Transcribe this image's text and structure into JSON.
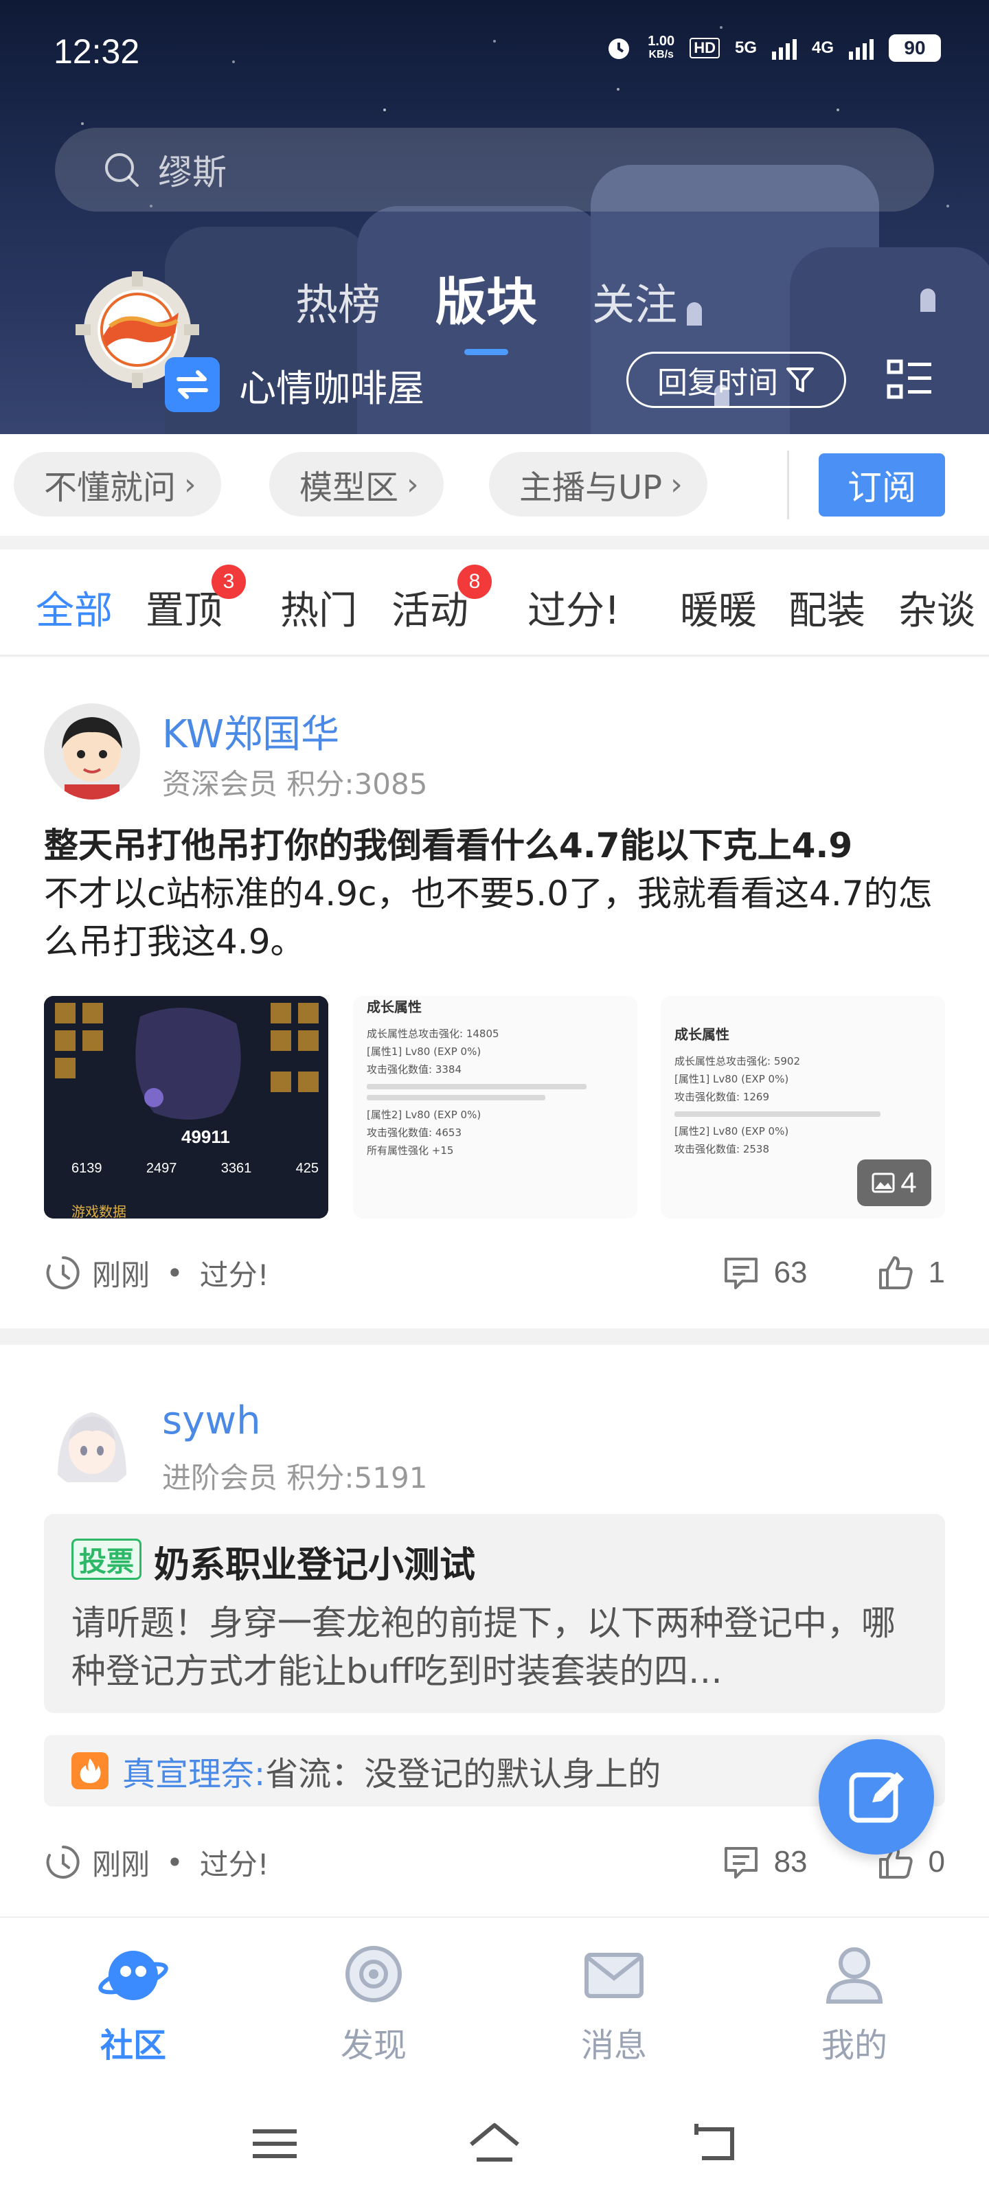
{
  "status_bar": {
    "time": "12:32",
    "speed_value": "1.00",
    "speed_unit": "KB/s",
    "hd": "HD",
    "net1": "5G",
    "net2": "4G",
    "battery": "90"
  },
  "header": {
    "search_placeholder": "缪斯",
    "tabs": [
      {
        "label": "热榜",
        "active": false
      },
      {
        "label": "版块",
        "active": true
      },
      {
        "label": "关注",
        "active": false
      }
    ],
    "forum_name": "心情咖啡屋",
    "sort_label": "回复时间"
  },
  "subforums": {
    "chips": [
      "不懂就问",
      "模型区",
      "主播与UP"
    ],
    "subscribe_label": "订阅"
  },
  "category_tabs": [
    {
      "label": "全部",
      "active": true,
      "badge": null
    },
    {
      "label": "置顶",
      "active": false,
      "badge": "3"
    },
    {
      "label": "热门",
      "active": false,
      "badge": null
    },
    {
      "label": "活动",
      "active": false,
      "badge": "8"
    },
    {
      "label": "过分!",
      "active": false,
      "badge": null
    },
    {
      "label": "暖暖",
      "active": false,
      "badge": null
    },
    {
      "label": "配装",
      "active": false,
      "badge": null
    },
    {
      "label": "杂谈",
      "active": false,
      "badge": null
    }
  ],
  "posts": [
    {
      "author": "KW郑国华",
      "rank": "资深会员",
      "score": "积分:3085",
      "title_bold": "整天吊打他吊打你的我倒看看什么4.7能以下克上4.9",
      "title_rest": "不才以c站标准的4.9c，也不要5.0了，我就看看这4.7的怎么吊打我这4.9。",
      "thumb1": {
        "score": "49911",
        "stats": [
          "6139",
          "2497",
          "3361",
          "425"
        ],
        "caption": "游戏数据"
      },
      "thumb2": {
        "heading": "成长属性",
        "lines": [
          "成长属性总攻击强化: 14805",
          "[属性1] Lv80 (EXP 0%)",
          "攻击强化数值: 3384",
          "[属性2] Lv80 (EXP 0%)",
          "攻击强化数值: 4653",
          "所有属性强化 +15"
        ]
      },
      "thumb3": {
        "heading": "成长属性",
        "lines": [
          "成长属性总攻击强化: 5902",
          "[属性1] Lv80 (EXP 0%)",
          "攻击强化数值: 1269",
          "[属性2] Lv80 (EXP 0%)",
          "攻击强化数值: 2538"
        ]
      },
      "image_count": "4",
      "time": "刚刚",
      "category": "过分!",
      "comments": "63",
      "likes": "1"
    },
    {
      "author": "sywh",
      "rank": "进阶会员",
      "score": "积分:5191",
      "vote_tag": "投票",
      "vote_title": "奶系职业登记小测试",
      "vote_desc": "请听题！身穿一套龙袍的前提下，以下两种登记中，哪种登记方式才能让buff吃到时装套装的四…",
      "hot_user": "真宣理奈:",
      "hot_text": "省流：没登记的默认身上的",
      "time": "刚刚",
      "category": "过分!",
      "comments": "83",
      "likes": "0"
    }
  ],
  "bottom_nav": [
    {
      "label": "社区",
      "icon": "planet-icon",
      "active": true
    },
    {
      "label": "发现",
      "icon": "discover-icon",
      "active": false
    },
    {
      "label": "消息",
      "icon": "mail-icon",
      "active": false
    },
    {
      "label": "我的",
      "icon": "profile-icon",
      "active": false
    }
  ],
  "colors": {
    "accent": "#3b8bff",
    "badge": "#f23a3a",
    "vote_green": "#2cb866",
    "author_blue": "#4a8ae6"
  }
}
